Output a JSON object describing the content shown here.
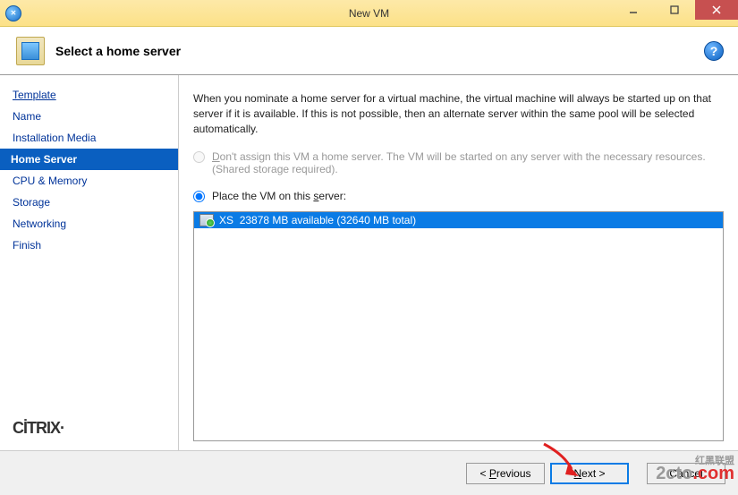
{
  "window": {
    "title": "New VM"
  },
  "header": {
    "heading": "Select a home server"
  },
  "sidebar": {
    "steps": [
      {
        "label": "Template"
      },
      {
        "label": "Name"
      },
      {
        "label": "Installation Media"
      },
      {
        "label": "Home Server"
      },
      {
        "label": "CPU & Memory"
      },
      {
        "label": "Storage"
      },
      {
        "label": "Networking"
      },
      {
        "label": "Finish"
      }
    ],
    "active_index": 3,
    "brand": "CİTRIX"
  },
  "main": {
    "intro": "When you nominate a home server for a virtual machine, the virtual machine will always be started up on that server if it is available. If this is not possible, then an alternate server within the same pool will be selected automatically.",
    "option_none_prefix": "D",
    "option_none_rest": "on't assign this VM a home server. The VM will be started on any server with the necessary resources. (Shared storage required).",
    "option_place_prefix": "Place the VM on this ",
    "option_place_key": "s",
    "option_place_suffix": "erver:",
    "servers": [
      {
        "name": "XS",
        "detail": "23878 MB available (32640 MB total)"
      }
    ]
  },
  "footer": {
    "prev_key": "P",
    "prev_rest": "revious",
    "next_key": "N",
    "next_rest": "ext >",
    "cancel": "Cancel"
  },
  "watermark": {
    "small": "红黑联盟",
    "main_a": "2cto",
    "main_b": ".com"
  }
}
